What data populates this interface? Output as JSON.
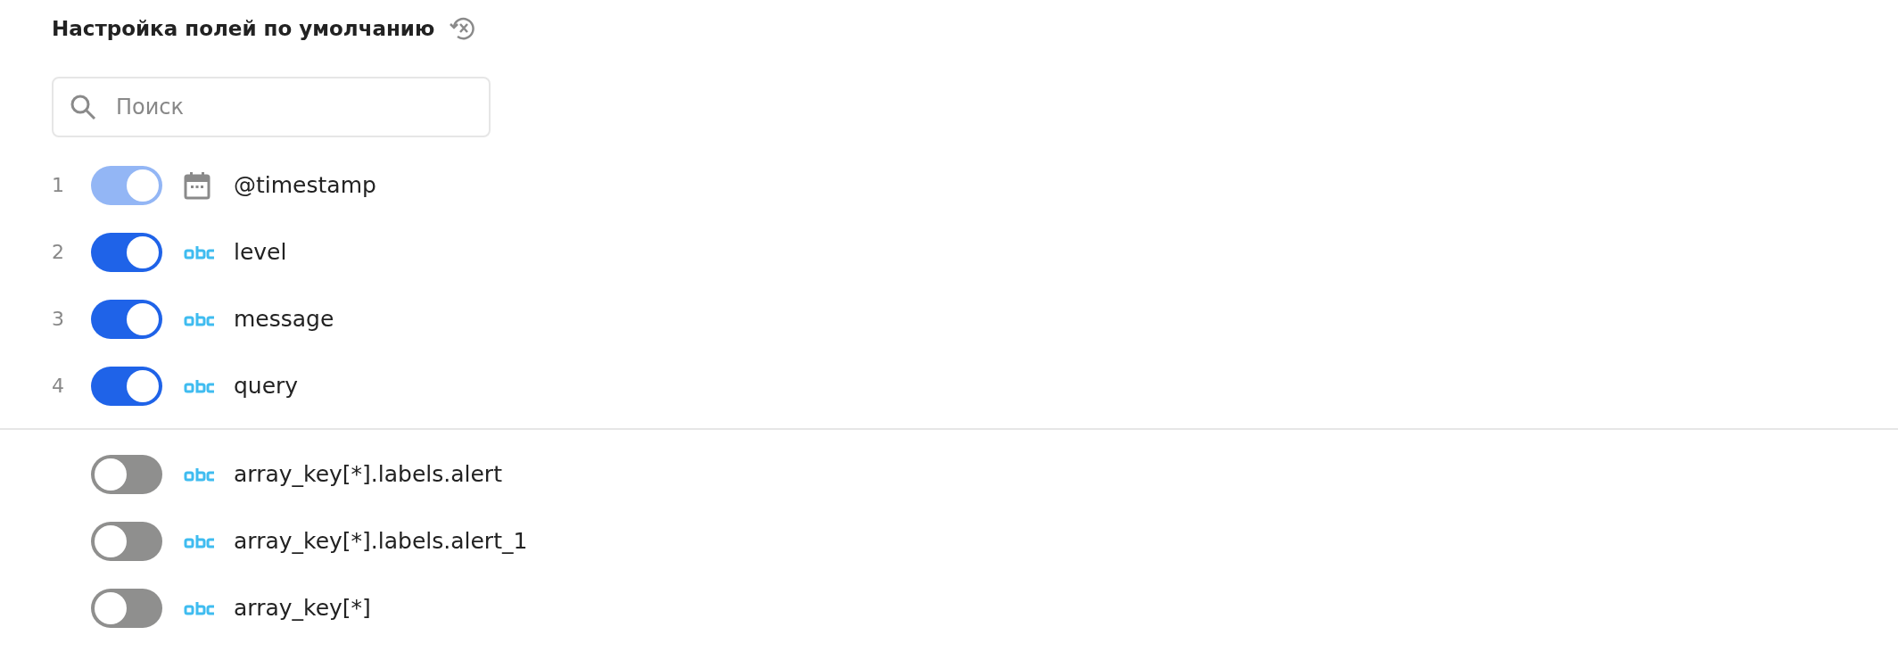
{
  "title": "Настройка полей по умолчанию",
  "search": {
    "placeholder": "Поиск"
  },
  "pinned_fields": [
    {
      "number": "1",
      "on": true,
      "disabled": true,
      "kind": "date",
      "name": "@timestamp"
    },
    {
      "number": "2",
      "on": true,
      "disabled": false,
      "kind": "string",
      "name": "level"
    },
    {
      "number": "3",
      "on": true,
      "disabled": false,
      "kind": "string",
      "name": "message"
    },
    {
      "number": "4",
      "on": true,
      "disabled": false,
      "kind": "string",
      "name": "query"
    }
  ],
  "other_fields": [
    {
      "on": false,
      "disabled": false,
      "kind": "string",
      "name": "array_key[*].labels.alert"
    },
    {
      "on": false,
      "disabled": false,
      "kind": "string",
      "name": "array_key[*].labels.alert_1"
    },
    {
      "on": false,
      "disabled": false,
      "kind": "string",
      "name": "array_key[*]"
    }
  ]
}
